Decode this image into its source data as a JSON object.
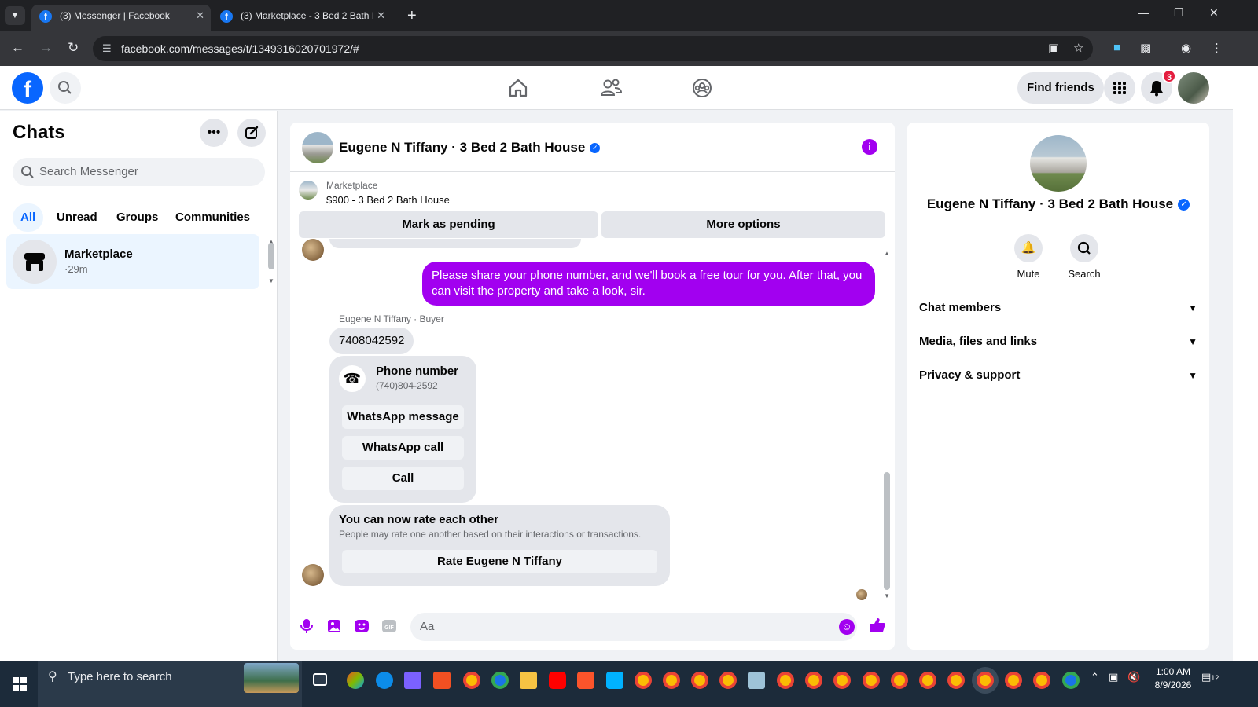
{
  "browser": {
    "tabs": [
      {
        "title": "(3) Messenger | Facebook",
        "active": true
      },
      {
        "title": "(3) Marketplace - 3 Bed 2 Bath I",
        "active": false
      }
    ],
    "url": "facebook.com/messages/t/1349316020701972/#"
  },
  "fb_header": {
    "find_friends": "Find friends",
    "notification_count": "3"
  },
  "sidebar": {
    "title": "Chats",
    "search_placeholder": "Search Messenger",
    "filters": [
      "All",
      "Unread",
      "Groups",
      "Communities"
    ],
    "chats": [
      {
        "name": "Marketplace",
        "time": "·29m"
      }
    ]
  },
  "conversation": {
    "title": "Eugene N Tiffany · 3 Bed 2 Bath House",
    "marketplace_label": "Marketplace",
    "listing": "$900 - 3 Bed 2 Bath House",
    "mark_pending": "Mark as pending",
    "more_options": "More options",
    "outgoing_message": "Please share your phone number, and we'll book a free tour for you. After that, you can visit the property and take a look, sir.",
    "sender_label": "Eugene N Tiffany · Buyer",
    "incoming_message": "7408042592",
    "phone_card": {
      "title": "Phone number",
      "number": "(740)804-2592",
      "buttons": [
        "WhatsApp message",
        "WhatsApp call",
        "Call"
      ]
    },
    "rate_card": {
      "title": "You can now rate each other",
      "subtitle": "People may rate one another based on their interactions or transactions.",
      "button": "Rate Eugene N Tiffany"
    },
    "composer_placeholder": "Aa"
  },
  "info_panel": {
    "name": "Eugene N Tiffany · 3 Bed 2 Bath House",
    "actions": [
      "Mute",
      "Search"
    ],
    "sections": [
      "Chat members",
      "Media, files and links",
      "Privacy & support"
    ]
  },
  "taskbar": {
    "search_placeholder": "Type here to search",
    "time": "1:00 AM",
    "date": "8/9/2026",
    "notification_count": "12"
  },
  "colors": {
    "accent": "#a200f0",
    "fb_blue": "#0866ff",
    "bubble_gray": "#e4e6eb"
  }
}
